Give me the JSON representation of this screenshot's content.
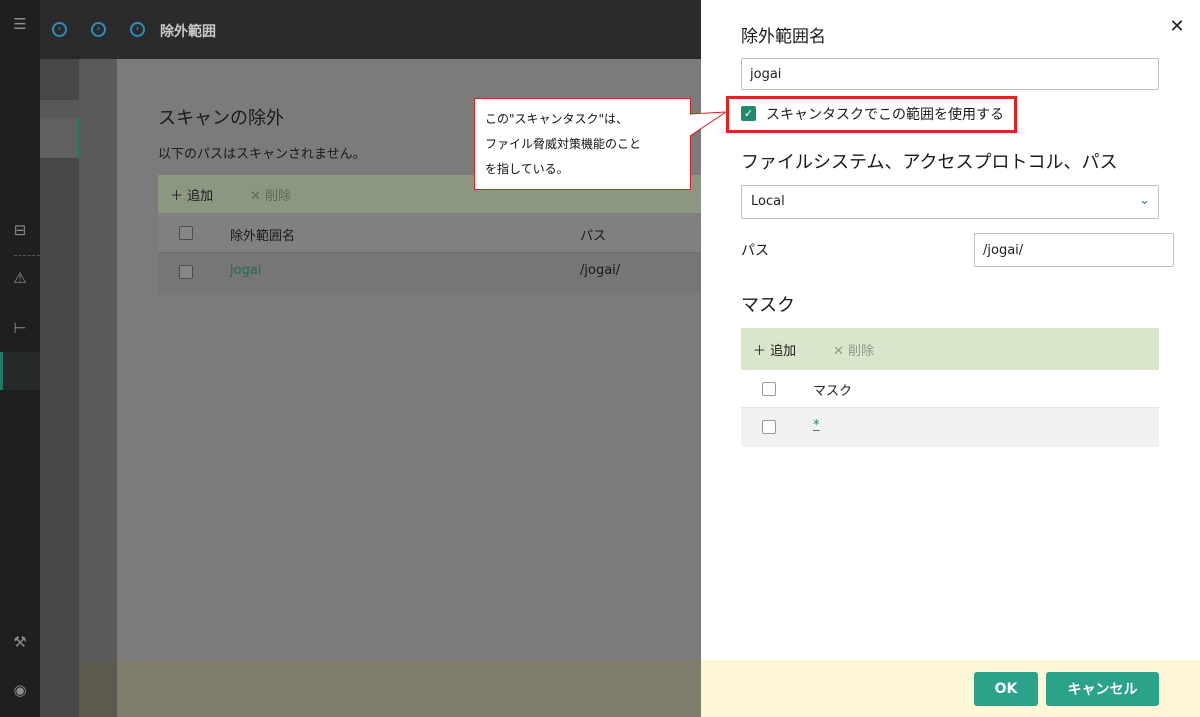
{
  "header": {
    "title": "除外範囲"
  },
  "exclusions": {
    "title": "スキャンの除外",
    "description": "以下のパスはスキャンされません。",
    "toolbar": {
      "add": "追加",
      "delete": "削除"
    },
    "columns": [
      "除外範囲名",
      "パス"
    ],
    "rows": [
      {
        "name": "jogai",
        "path": "/jogai/"
      }
    ]
  },
  "callout": {
    "lines": [
      "この\"スキャンタスク\"は、",
      "ファイル脅威対策機能のこと",
      "を指している。"
    ]
  },
  "panel": {
    "name_label": "除外範囲名",
    "name_value": "jogai",
    "use_scan_task_label": "スキャンタスクでこの範囲を使用する",
    "use_scan_task_checked": true,
    "fs_heading": "ファイルシステム、アクセスプロトコル、パス",
    "fs_value": "Local",
    "path_label": "パス",
    "path_value": "/jogai/",
    "mask_heading": "マスク",
    "mask_toolbar": {
      "add": "追加",
      "delete": "削除"
    },
    "mask_column": "マスク",
    "mask_rows": [
      "*"
    ],
    "ok": "OK",
    "cancel": "キャンセル"
  },
  "colors": {
    "accent": "#2aa38a",
    "highlight": "#e02424",
    "link": "#1f8a6e"
  }
}
